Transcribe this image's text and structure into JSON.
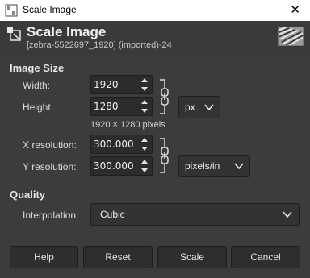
{
  "window": {
    "title": "Scale Image",
    "close_glyph": "✕"
  },
  "header": {
    "title": "Scale Image",
    "subtitle": "[zebra-5522697_1920] (imported)-24"
  },
  "image_size": {
    "section_title": "Image Size",
    "width_label": "Width:",
    "width_value": "1920",
    "height_label": "Height:",
    "height_value": "1280",
    "size_hint": "1920 × 1280 pixels",
    "unit": "px",
    "x_res_label": "X resolution:",
    "x_res_value": "300.000",
    "y_res_label": "Y resolution:",
    "y_res_value": "300.000",
    "res_unit": "pixels/in"
  },
  "quality": {
    "section_title": "Quality",
    "interp_label": "Interpolation:",
    "interp_value": "Cubic"
  },
  "buttons": {
    "help": "Help",
    "reset": "Reset",
    "scale": "Scale",
    "cancel": "Cancel"
  },
  "icons": {
    "app": "gimp-app-icon",
    "header": "scale-image-icon",
    "chain": "chain-link-icon",
    "chevron": "chevron-down-icon",
    "close": "close-icon"
  },
  "colors": {
    "background": "#3c3c3c",
    "field": "#2c2c2c",
    "text": "#dcdcdc",
    "titlebar": "#ffffff"
  }
}
